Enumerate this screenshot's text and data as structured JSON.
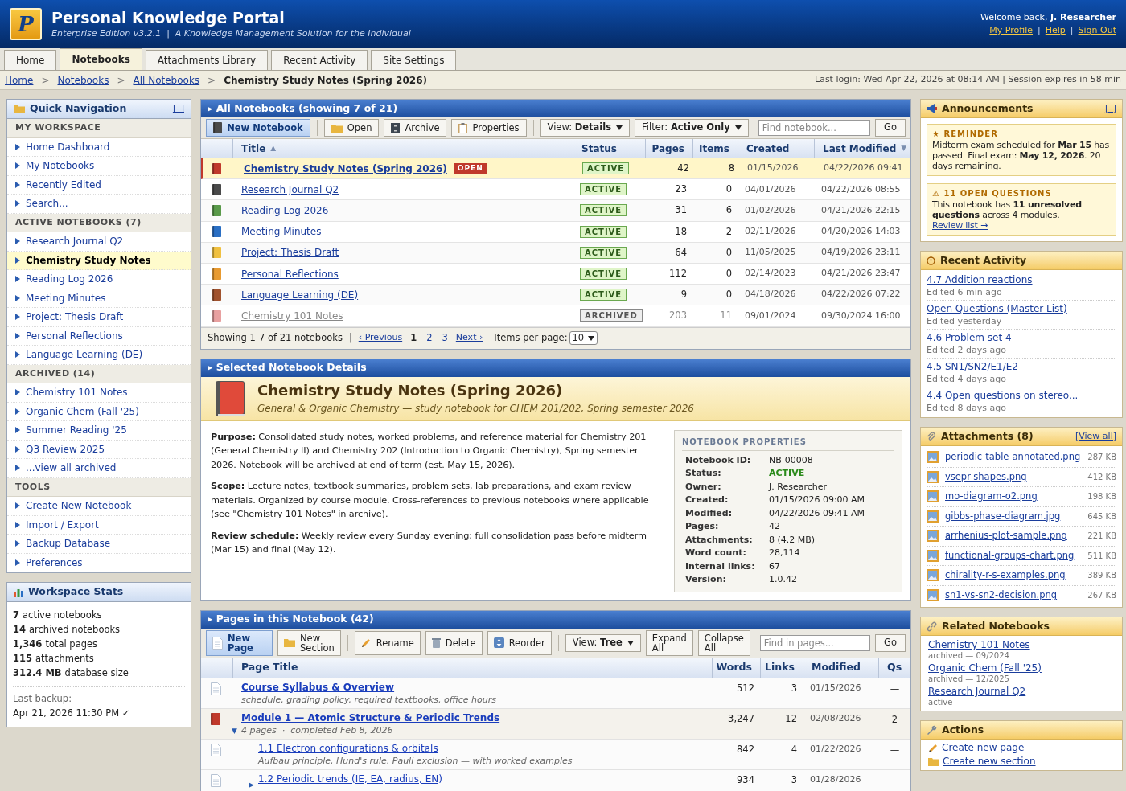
{
  "header": {
    "logo": "P",
    "title": "Personal Knowledge Portal",
    "subtitle": "Enterprise Edition v3.2.1  |  A Knowledge Management Solution for the Individual",
    "welcome": "Welcome back,",
    "user": "J. Researcher",
    "links": [
      "My Profile",
      "Help",
      "Sign Out"
    ],
    "link_separator": "|"
  },
  "tabs": [
    {
      "label": "Home",
      "selected": false
    },
    {
      "label": "Notebooks",
      "selected": true
    },
    {
      "label": "Attachments Library",
      "selected": false
    },
    {
      "label": "Recent Activity",
      "selected": false
    },
    {
      "label": "Site Settings",
      "selected": false
    }
  ],
  "breadcrumb": {
    "links": [
      "Home",
      "Notebooks",
      "All Notebooks"
    ],
    "separator": ">",
    "current": "Chemistry Study Notes (Spring 2026)",
    "session": "Last login: Wed Apr 22, 2026 at 08:14 AM | Session expires in 58 min"
  },
  "quick_nav": {
    "title": "Quick Navigation",
    "toggle": "[–]",
    "sections": [
      {
        "heading": "MY WORKSPACE",
        "items": [
          {
            "label": "Home Dashboard",
            "selected": false
          },
          {
            "label": "My Notebooks",
            "selected": false
          },
          {
            "label": "Recently Edited",
            "selected": false
          },
          {
            "label": "Search...",
            "selected": false
          }
        ]
      },
      {
        "heading": "ACTIVE NOTEBOOKS (7)",
        "items": [
          {
            "label": "Research Journal Q2",
            "selected": false
          },
          {
            "label": "Chemistry Study Notes",
            "selected": true
          },
          {
            "label": "Reading Log 2026",
            "selected": false
          },
          {
            "label": "Meeting Minutes",
            "selected": false
          },
          {
            "label": "Project: Thesis Draft",
            "selected": false
          },
          {
            "label": "Personal Reflections",
            "selected": false
          },
          {
            "label": "Language Learning (DE)",
            "selected": false
          }
        ]
      },
      {
        "heading": "ARCHIVED (14)",
        "items": [
          {
            "label": "Chemistry 101 Notes",
            "selected": false
          },
          {
            "label": "Organic Chem (Fall '25)",
            "selected": false
          },
          {
            "label": "Summer Reading '25",
            "selected": false
          },
          {
            "label": "Q3 Review 2025",
            "selected": false
          },
          {
            "label": "...view all archived",
            "selected": false
          }
        ]
      },
      {
        "heading": "TOOLS",
        "items": [
          {
            "label": "Create New Notebook",
            "selected": false
          },
          {
            "label": "Import / Export",
            "selected": false
          },
          {
            "label": "Backup Database",
            "selected": false
          },
          {
            "label": "Preferences",
            "selected": false
          }
        ]
      }
    ]
  },
  "workspace_stats": {
    "title": "Workspace Stats",
    "lines": [
      {
        "number": "7",
        "description": "active notebooks"
      },
      {
        "number": "14",
        "description": "archived notebooks"
      },
      {
        "number": "1,346",
        "description": "total pages"
      },
      {
        "number": "115",
        "description": "attachments"
      },
      {
        "number": "312.4 MB",
        "description": "database size"
      }
    ],
    "backup_label": "Last backup:",
    "backup_value": "Apr 21, 2026 11:30 PM ✓"
  },
  "notebooks": {
    "title": "▸ All Notebooks (showing 7 of 21)",
    "toolbar": [
      [
        {
          "kind": "primary",
          "label": "New Notebook"
        }
      ],
      [
        {
          "kind": "button",
          "label": "Open"
        },
        {
          "kind": "button",
          "label": "Archive"
        },
        {
          "kind": "button",
          "label": "Properties"
        }
      ],
      [
        {
          "kind": "dropdown",
          "label": "View:",
          "value": "Details"
        },
        {
          "kind": "dropdown",
          "label": "Filter:",
          "value": "Active Only"
        }
      ]
    ],
    "search": {
      "placeholder": "Find notebook...",
      "button": "Go"
    },
    "columns": [
      {
        "label": "Title",
        "sort_arrow": "▲"
      },
      {
        "label": "Status"
      },
      {
        "label": "Pages"
      },
      {
        "label": "Items"
      },
      {
        "label": "Created"
      },
      {
        "label": "Last Modified",
        "sort_arrow": "▼"
      }
    ],
    "rows": [
      {
        "title": "Chemistry Study Notes (Spring 2026)",
        "badge": "OPEN",
        "status": "ACTIVE",
        "archived": false,
        "pages": "42",
        "items": "8",
        "created": "01/15/2026",
        "modified": "04/22/2026 09:41",
        "selected": true,
        "color": "#c0392b"
      },
      {
        "title": "Research Journal Q2",
        "status": "ACTIVE",
        "archived": false,
        "pages": "23",
        "items": "0",
        "created": "04/01/2026",
        "modified": "04/22/2026 08:55",
        "selected": false,
        "color": "#4a4a4a"
      },
      {
        "title": "Reading Log 2026",
        "status": "ACTIVE",
        "archived": false,
        "pages": "31",
        "items": "6",
        "created": "01/02/2026",
        "modified": "04/21/2026 22:15",
        "selected": false,
        "color": "#5a9a4a"
      },
      {
        "title": "Meeting Minutes",
        "status": "ACTIVE",
        "archived": false,
        "pages": "18",
        "items": "2",
        "created": "02/11/2026",
        "modified": "04/20/2026 14:03",
        "selected": false,
        "color": "#2a6fc4"
      },
      {
        "title": "Project: Thesis Draft",
        "status": "ACTIVE",
        "archived": false,
        "pages": "64",
        "items": "0",
        "created": "11/05/2025",
        "modified": "04/19/2026 23:11",
        "selected": false,
        "color": "#f0c040"
      },
      {
        "title": "Personal Reflections",
        "status": "ACTIVE",
        "archived": false,
        "pages": "112",
        "items": "0",
        "created": "02/14/2023",
        "modified": "04/21/2026 23:47",
        "selected": false,
        "color": "#e89a30"
      },
      {
        "title": "Language Learning (DE)",
        "status": "ACTIVE",
        "archived": false,
        "pages": "9",
        "items": "0",
        "created": "04/18/2026",
        "modified": "04/22/2026 07:22",
        "selected": false,
        "color": "#a0522d"
      },
      {
        "title": "Chemistry 101 Notes",
        "status": "ARCHIVED",
        "archived": true,
        "pages": "203",
        "items": "11",
        "created": "09/01/2024",
        "modified": "09/30/2024 16:00",
        "selected": false,
        "color": "#e8a0a0"
      }
    ],
    "pagination": {
      "summary": "Showing 1-7 of 21 notebooks",
      "separator": "|",
      "prev": "‹ Previous",
      "pages": [
        {
          "label": "1",
          "selected": true
        },
        {
          "label": "2",
          "selected": false
        },
        {
          "label": "3",
          "selected": false
        }
      ],
      "next": "Next ›",
      "per_page_label": "Items per page:",
      "per_page": "10"
    }
  },
  "details": {
    "title": "▸ Selected Notebook Details",
    "name": "Chemistry Study Notes (Spring 2026)",
    "subtitle": "General & Organic Chemistry — study notebook for CHEM 201/202, Spring semester 2026",
    "paragraphs": [
      {
        "label": "Purpose:",
        "text": "Consolidated study notes, worked problems, and reference material for Chemistry 201 (General Chemistry II) and Chemistry 202 (Introduction to Organic Chemistry), Spring semester 2026. Notebook will be archived at end of term (est. May 15, 2026)."
      },
      {
        "label": "Scope:",
        "text": "Lecture notes, textbook summaries, problem sets, lab preparations, and exam review materials. Organized by course module. Cross-references to previous notebooks where applicable (see \"Chemistry 101 Notes\" in archive)."
      },
      {
        "label": "Review schedule:",
        "text": "Weekly review every Sunday evening; full consolidation pass before midterm (Mar 15) and final (May 12)."
      }
    ],
    "properties": {
      "title": "NOTEBOOK PROPERTIES",
      "rows": [
        {
          "label": "Notebook ID:",
          "value": "NB-00008",
          "kind": "text"
        },
        {
          "label": "Status:",
          "value": "ACTIVE",
          "kind": "status"
        },
        {
          "label": "Owner:",
          "value": "J. Researcher",
          "kind": "text"
        },
        {
          "label": "Created:",
          "value": "01/15/2026 09:00 AM",
          "kind": "text"
        },
        {
          "label": "Modified:",
          "value": "04/22/2026 09:41 AM",
          "kind": "text"
        },
        {
          "label": "Pages:",
          "value": "42",
          "kind": "text"
        },
        {
          "label": "Attachments:",
          "value": "8 (4.2 MB)",
          "kind": "text"
        },
        {
          "label": "Word count:",
          "value": "28,114",
          "kind": "text"
        },
        {
          "label": "Internal links:",
          "value": "67",
          "kind": "text"
        },
        {
          "label": "Version:",
          "value": "1.0.42",
          "kind": "text"
        }
      ]
    }
  },
  "pages": {
    "title": "▸ Pages in this Notebook (42)",
    "toolbar": [
      [
        {
          "kind": "primary",
          "label": "New Page"
        },
        {
          "kind": "button",
          "label": "New Section"
        }
      ],
      [
        {
          "kind": "button",
          "label": "Rename"
        },
        {
          "kind": "button",
          "label": "Delete"
        },
        {
          "kind": "button",
          "label": "Reorder"
        }
      ],
      [
        {
          "kind": "dropdown",
          "label": "View:",
          "value": "Tree"
        },
        {
          "kind": "button",
          "label": "Expand All"
        },
        {
          "kind": "button",
          "label": "Collapse All"
        }
      ]
    ],
    "search": {
      "placeholder": "Find in pages...",
      "button": "Go"
    },
    "columns": [
      "Page Title",
      "Words",
      "Links",
      "Modified",
      "Qs"
    ],
    "rows": [
      {
        "kind": "page",
        "title": "Course Syllabus & Overview",
        "note": "schedule, grading policy, required textbooks, office hours",
        "words": "512",
        "links": "3",
        "modified": "01/15/2026",
        "qs": "—"
      },
      {
        "kind": "section",
        "toggle": "▼",
        "title": "Module 1 — Atomic Structure & Periodic Trends",
        "note": "4 pages  ·  completed Feb 8, 2026",
        "words": "3,247",
        "links": "12",
        "modified": "02/08/2026",
        "qs": "2",
        "children": [
          {
            "kind": "page",
            "title": "1.1 Electron configurations & orbitals",
            "note": "Aufbau principle, Hund's rule, Pauli exclusion — with worked examples",
            "words": "842",
            "links": "4",
            "modified": "01/22/2026",
            "qs": "—"
          },
          {
            "kind": "page",
            "toggle": "▶",
            "title": "1.2 Periodic trends (IE, EA, radius, EN)",
            "words": "934",
            "links": "3",
            "modified": "01/28/2026",
            "qs": "—"
          }
        ]
      }
    ]
  },
  "announcements": {
    "title": "Announcements",
    "toggle": "[–]",
    "notices": [
      {
        "heading": "★ REMINDER",
        "text": "Midterm exam scheduled for **Mar 15** has passed. Final exam: **May 12, 2026**. 20 days remaining."
      },
      {
        "heading": "⚠ 11 OPEN QUESTIONS",
        "text": "This notebook has **11 unresolved questions** across 4 modules.",
        "link": "Review list →"
      }
    ]
  },
  "recent_activity": {
    "title": "Recent Activity",
    "items": [
      {
        "label": "4.7 Addition reactions",
        "meta": "Edited 6 min ago"
      },
      {
        "label": "Open Questions (Master List)",
        "meta": "Edited yesterday"
      },
      {
        "label": "4.6 Problem set 4",
        "meta": "Edited 2 days ago"
      },
      {
        "label": "4.5 SN1/SN2/E1/E2",
        "meta": "Edited 4 days ago"
      },
      {
        "label": "4.4 Open questions on stereo...",
        "meta": "Edited 8 days ago"
      }
    ]
  },
  "attachments": {
    "title": "Attachments (8)",
    "view_all": "[View all]",
    "items": [
      {
        "name": "periodic-table-annotated.png",
        "size": "287 KB"
      },
      {
        "name": "vsepr-shapes.png",
        "size": "412 KB"
      },
      {
        "name": "mo-diagram-o2.png",
        "size": "198 KB"
      },
      {
        "name": "gibbs-phase-diagram.jpg",
        "size": "645 KB"
      },
      {
        "name": "arrhenius-plot-sample.png",
        "size": "221 KB"
      },
      {
        "name": "functional-groups-chart.png",
        "size": "511 KB"
      },
      {
        "name": "chirality-r-s-examples.png",
        "size": "389 KB"
      },
      {
        "name": "sn1-vs-sn2-decision.png",
        "size": "267 KB"
      }
    ]
  },
  "related": {
    "title": "Related Notebooks",
    "items": [
      {
        "label": "Chemistry 101 Notes",
        "meta": "archived — 09/2024"
      },
      {
        "label": "Organic Chem (Fall '25)",
        "meta": "archived — 12/2025"
      },
      {
        "label": "Research Journal Q2",
        "meta": "active"
      }
    ]
  },
  "actions": {
    "title": "Actions",
    "items": [
      "Create new page",
      "Create new section"
    ]
  }
}
